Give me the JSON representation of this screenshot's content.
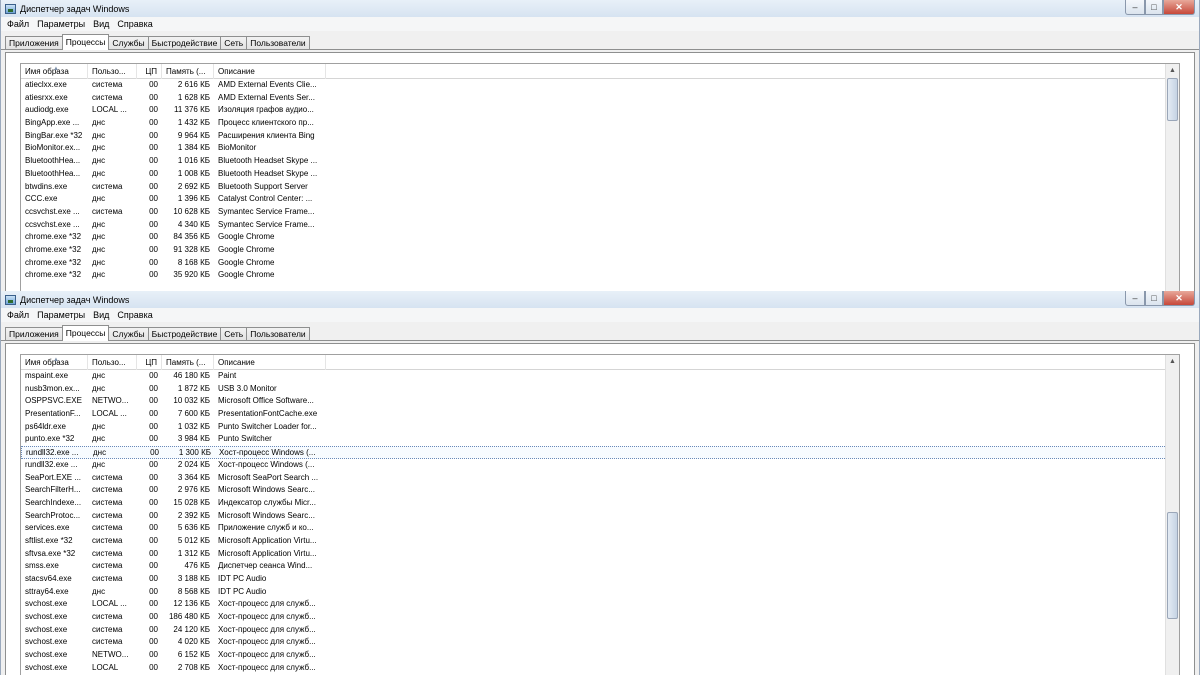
{
  "window_title": "Диспетчер задач Windows",
  "controls": {
    "minimize": "‒",
    "maximize": "□",
    "close": "✕"
  },
  "menu": [
    "Файл",
    "Параметры",
    "Вид",
    "Справка"
  ],
  "tabs": [
    "Приложения",
    "Процессы",
    "Службы",
    "Быстродействие",
    "Сеть",
    "Пользователи"
  ],
  "active_tab": 1,
  "columns": [
    "Имя образа",
    "Пользо...",
    "ЦП",
    "Память (...",
    "Описание"
  ],
  "top_processes": [
    [
      "atieclxx.exe",
      "система",
      "00",
      "2 616 КБ",
      "AMD External Events Clie..."
    ],
    [
      "atiesrxx.exe",
      "система",
      "00",
      "1 628 КБ",
      "AMD External Events Ser..."
    ],
    [
      "audiodg.exe",
      "LOCAL ...",
      "00",
      "11 376 КБ",
      "Изоляция графов аудио..."
    ],
    [
      "BingApp.exe ...",
      "днс",
      "00",
      "1 432 КБ",
      "Процесс клиентского пр..."
    ],
    [
      "BingBar.exe *32",
      "днс",
      "00",
      "9 964 КБ",
      "Расширения клиента Bing"
    ],
    [
      "BioMonitor.ex...",
      "днс",
      "00",
      "1 384 КБ",
      "BioMonitor"
    ],
    [
      "BluetoothHea...",
      "днс",
      "00",
      "1 016 КБ",
      "Bluetooth Headset Skype ..."
    ],
    [
      "BluetoothHea...",
      "днс",
      "00",
      "1 008 КБ",
      "Bluetooth Headset Skype ..."
    ],
    [
      "btwdins.exe",
      "система",
      "00",
      "2 692 КБ",
      "Bluetooth Support Server"
    ],
    [
      "CCC.exe",
      "днс",
      "00",
      "1 396 КБ",
      "Catalyst Control Center: ..."
    ],
    [
      "ccsvchst.exe ...",
      "система",
      "00",
      "10 628 КБ",
      "Symantec Service Frame..."
    ],
    [
      "ccsvchst.exe ...",
      "днс",
      "00",
      "4 340 КБ",
      "Symantec Service Frame..."
    ],
    [
      "chrome.exe *32",
      "днс",
      "00",
      "84 356 КБ",
      "Google Chrome"
    ],
    [
      "chrome.exe *32",
      "днс",
      "00",
      "91 328 КБ",
      "Google Chrome"
    ],
    [
      "chrome.exe *32",
      "днс",
      "00",
      "8 168 КБ",
      "Google Chrome"
    ],
    [
      "chrome.exe *32",
      "днс",
      "00",
      "35 920 КБ",
      "Google Chrome"
    ]
  ],
  "bottom_processes": [
    [
      "mspaint.exe",
      "днс",
      "00",
      "46 180 КБ",
      "Paint"
    ],
    [
      "nusb3mon.ex...",
      "днс",
      "00",
      "1 872 КБ",
      "USB 3.0 Monitor"
    ],
    [
      "OSPPSVC.EXE",
      "NETWO...",
      "00",
      "10 032 КБ",
      "Microsoft Office Software..."
    ],
    [
      "PresentationF...",
      "LOCAL ...",
      "00",
      "7 600 КБ",
      "PresentationFontCache.exe"
    ],
    [
      "ps64ldr.exe",
      "днс",
      "00",
      "1 032 КБ",
      "Punto Switcher Loader for..."
    ],
    [
      "punto.exe *32",
      "днс",
      "00",
      "3 984 КБ",
      "Punto Switcher"
    ],
    [
      "rundll32.exe ...",
      "днс",
      "00",
      "1 300 КБ",
      "Хост-процесс Windows (..."
    ],
    [
      "rundll32.exe ...",
      "днс",
      "00",
      "2 024 КБ",
      "Хост-процесс Windows (..."
    ],
    [
      "SeaPort.EXE ...",
      "система",
      "00",
      "3 364 КБ",
      "Microsoft SeaPort Search ..."
    ],
    [
      "SearchFilterH...",
      "система",
      "00",
      "2 976 КБ",
      "Microsoft Windows Searc..."
    ],
    [
      "SearchIndexe...",
      "система",
      "00",
      "15 028 КБ",
      "Индексатор службы Micr..."
    ],
    [
      "SearchProtoc...",
      "система",
      "00",
      "2 392 КБ",
      "Microsoft Windows Searc..."
    ],
    [
      "services.exe",
      "система",
      "00",
      "5 636 КБ",
      "Приложение служб и ко..."
    ],
    [
      "sftlist.exe *32",
      "система",
      "00",
      "5 012 КБ",
      "Microsoft Application Virtu..."
    ],
    [
      "sftvsa.exe *32",
      "система",
      "00",
      "1 312 КБ",
      "Microsoft Application Virtu..."
    ],
    [
      "smss.exe",
      "система",
      "00",
      "476 КБ",
      "Диспетчер сеанса  Wind..."
    ],
    [
      "stacsv64.exe",
      "система",
      "00",
      "3 188 КБ",
      "IDT PC Audio"
    ],
    [
      "sttray64.exe",
      "днс",
      "00",
      "8 568 КБ",
      "IDT PC Audio"
    ],
    [
      "svchost.exe",
      "LOCAL ...",
      "00",
      "12 136 КБ",
      "Хост-процесс для служб..."
    ],
    [
      "svchost.exe",
      "система",
      "00",
      "186 480 КБ",
      "Хост-процесс для служб..."
    ],
    [
      "svchost.exe",
      "система",
      "00",
      "24 120 КБ",
      "Хост-процесс для служб..."
    ],
    [
      "svchost.exe",
      "система",
      "00",
      "4 020 КБ",
      "Хост-процесс для служб..."
    ],
    [
      "svchost.exe",
      "NETWO...",
      "00",
      "6 152 КБ",
      "Хост-процесс для служб..."
    ],
    [
      "svchost.exe",
      "LOCAL",
      "00",
      "2 708 КБ",
      "Хост-процесс для служб..."
    ]
  ],
  "selected_bottom_row": 6,
  "scroll": {
    "top_position": 0.0,
    "top_visible_fraction": 0.2,
    "bottom_position": 0.72,
    "bottom_visible_fraction": 0.35
  },
  "colors": {
    "title_gradient": "#d6e3f1",
    "selection_border": "#6a89b8",
    "close_button": "#c6483a"
  }
}
